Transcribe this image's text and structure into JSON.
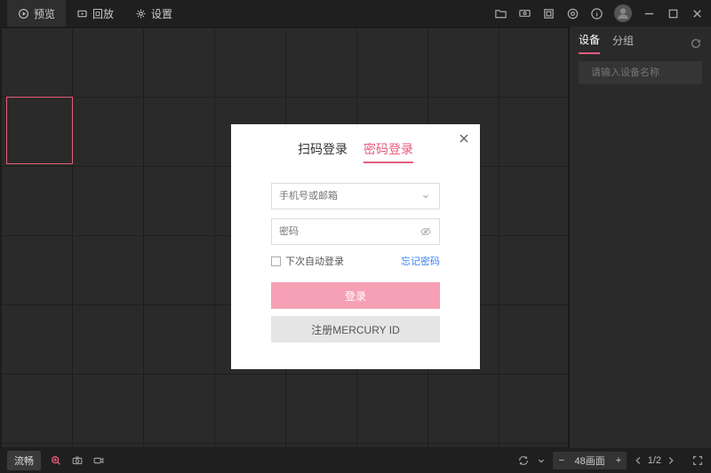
{
  "topbar": {
    "tabs": [
      {
        "label": "预览",
        "active": true
      },
      {
        "label": "回放",
        "active": false
      },
      {
        "label": "设置",
        "active": false
      }
    ]
  },
  "side": {
    "tabs": [
      {
        "label": "设备",
        "active": true
      },
      {
        "label": "分组",
        "active": false
      }
    ],
    "search_placeholder": "请输入设备名称"
  },
  "bottombar": {
    "quality_label": "流畅",
    "view_label": "48画面",
    "page_label": "1/2"
  },
  "modal": {
    "tab_qr": "扫码登录",
    "tab_pwd": "密码登录",
    "placeholder_account": "手机号或邮箱",
    "placeholder_password": "密码",
    "auto_login_label": "下次自动登录",
    "forgot_label": "忘记密码",
    "login_btn": "登录",
    "register_btn": "注册MERCURY ID"
  }
}
